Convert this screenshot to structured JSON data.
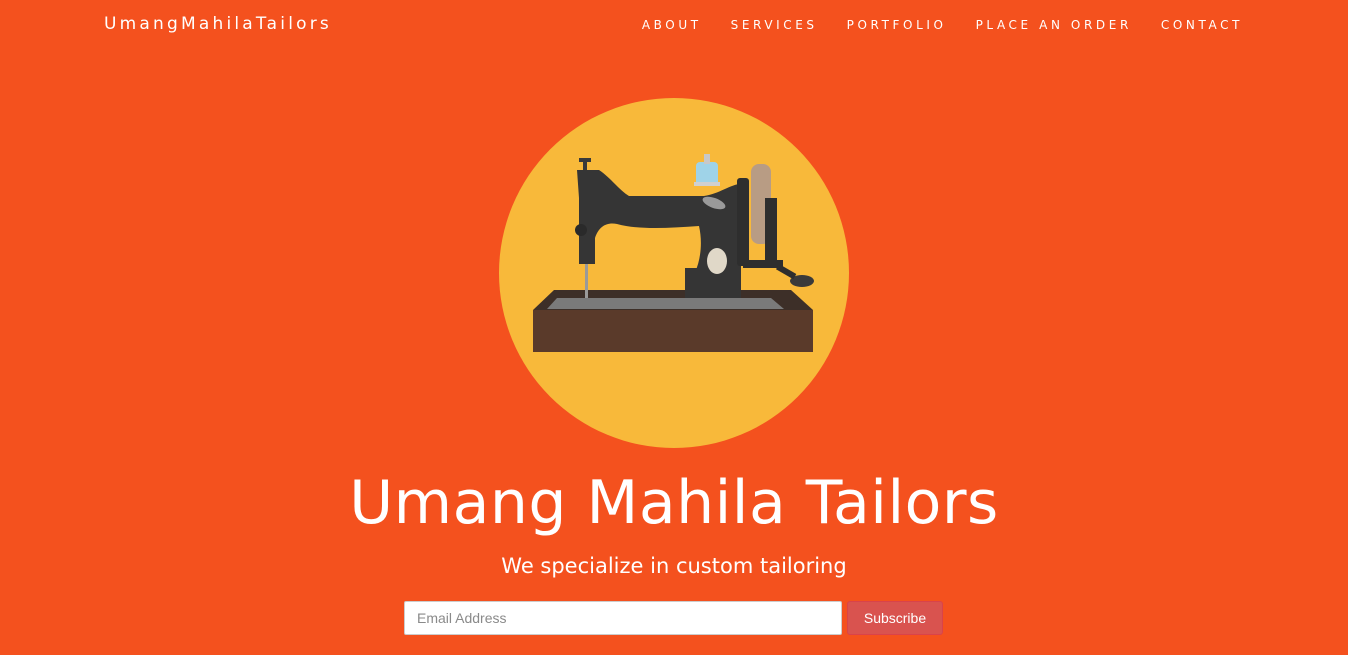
{
  "navbar": {
    "brand": "UmangMahilaTailors",
    "items": [
      {
        "label": "ABOUT"
      },
      {
        "label": "SERVICES"
      },
      {
        "label": "PORTFOLIO"
      },
      {
        "label": "PLACE AN ORDER"
      },
      {
        "label": "CONTACT"
      }
    ]
  },
  "hero": {
    "image_icon": "sewing-machine-icon",
    "title": "Umang Mahila Tailors",
    "subtitle": "We specialize in custom tailoring"
  },
  "subscribe_form": {
    "email_placeholder": "Email Address",
    "email_value": "",
    "button_label": "Subscribe"
  },
  "colors": {
    "background": "#f4511e",
    "circle": "#f8b93a",
    "button": "#d9534f",
    "text": "#ffffff"
  }
}
